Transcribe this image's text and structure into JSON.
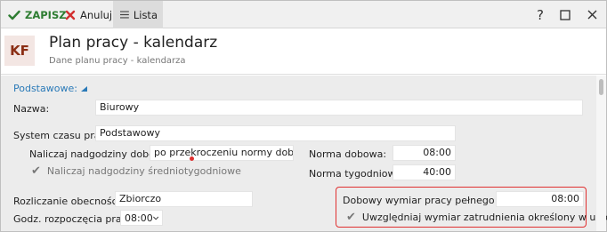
{
  "toolbar": {
    "save_label": "ZAPISZ",
    "cancel_label": "Anuluj",
    "list_label": "Lista",
    "help_glyph": "?",
    "maximize_glyph": "☐",
    "close_glyph": "✕"
  },
  "header": {
    "avatar_text": "KF",
    "title": "Plan pracy - kalendarz",
    "subtitle": "Dane planu pracy - kalendarza"
  },
  "section": {
    "label": "Podstawowe:"
  },
  "form": {
    "nazwa_label": "Nazwa:",
    "nazwa_value": "Biurowy",
    "system_label": "System czasu pracy:",
    "system_value": "Podstawowy",
    "nadgodziny_label": "Naliczaj nadgodziny dobowe:",
    "nadgodziny_value": "po przekroczeniu normy dobowej",
    "norma_dobowa_label": "Norma dobowa:",
    "norma_dobowa_value": "08:00",
    "srednio_label": "Naliczaj nadgodziny średniotygodniowe",
    "norma_tyg_label": "Norma tygodniowa:",
    "norma_tyg_value": "40:00",
    "rozliczanie_label": "Rozliczanie obecności:",
    "rozliczanie_value": "Zbiorczo",
    "godz_label": "Godz. rozpoczęcia pracy:",
    "godz_value": "08:00",
    "wymiar_label": "Dobowy wymiar pracy pełnego etatu:",
    "wymiar_value": "08:00",
    "uwzgledniaj_label": "Uwzględniaj wymiar zatrudnienia określony w umowie"
  },
  "colors": {
    "save_green": "#2e7d32",
    "cancel_red": "#d32f2f",
    "link_blue": "#2a7ab8",
    "highlight_red": "#e03030",
    "avatar_bg": "#f3e6e3",
    "avatar_fg": "#8b2e14"
  },
  "icons": {
    "save": "check-icon",
    "cancel": "x-icon",
    "list": "hamburger-icon",
    "help": "question-icon",
    "maximize": "square-icon",
    "close": "close-icon",
    "section_toggle": "triangle-up-icon",
    "checkbox": "checkmark-icon",
    "select": "chevron-down-icon"
  }
}
